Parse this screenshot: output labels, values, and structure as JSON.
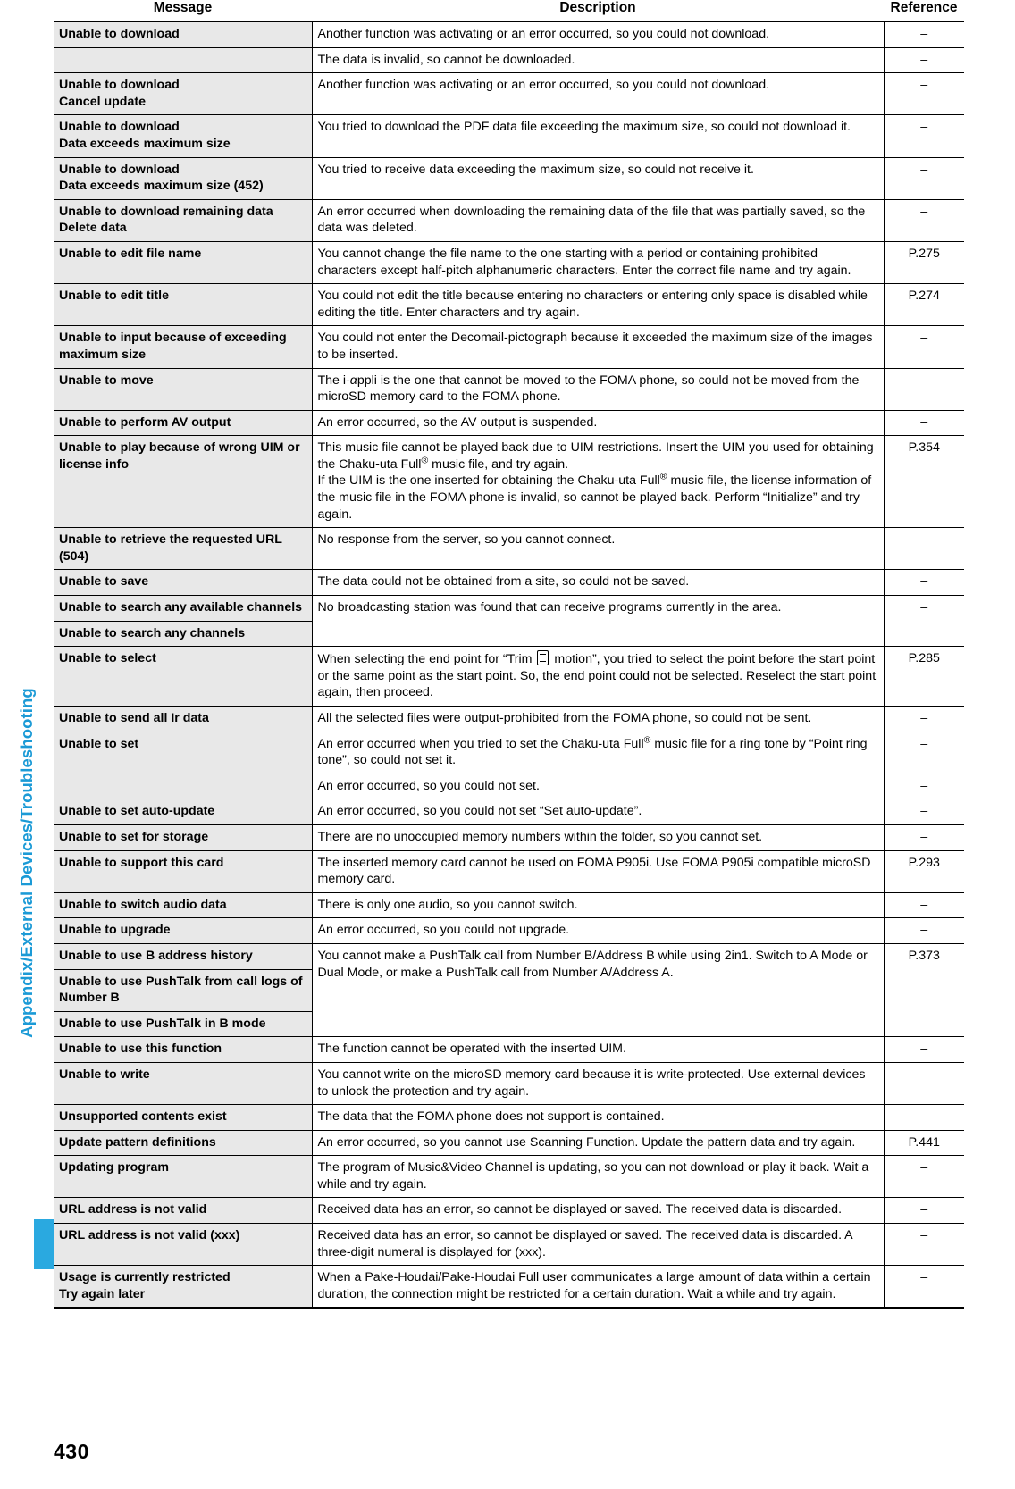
{
  "sidebar": {
    "chapter_label": "Appendix/External Devices/Troubleshooting"
  },
  "footer": {
    "page_number": "430"
  },
  "table": {
    "headers": {
      "message": "Message",
      "description": "Description",
      "reference": "Reference"
    },
    "rows": [
      {
        "message": "Unable to download",
        "description": "Another function was activating or an error occurred, so you could not download.",
        "reference": "–"
      },
      {
        "message": "",
        "description": "The data is invalid, so cannot be downloaded.",
        "reference": "–"
      },
      {
        "message": "Unable to download\nCancel update",
        "description": "Another function was activating or an error occurred, so you could not download.",
        "reference": "–"
      },
      {
        "message": "Unable to download\nData exceeds maximum size",
        "description": "You tried to download the PDF data file exceeding the maximum size, so could not download it.",
        "reference": "–"
      },
      {
        "message": "Unable to download\nData exceeds maximum size (452)",
        "description": "You tried to receive data exceeding the maximum size, so could not receive it.",
        "reference": "–"
      },
      {
        "message": "Unable to download remaining data\nDelete data",
        "description": "An error occurred when downloading the remaining data of the file that was partially saved, so the data was deleted.",
        "reference": "–"
      },
      {
        "message": "Unable to edit file name",
        "description": "You cannot change the file name to the one starting with a period or containing prohibited characters except half-pitch alphanumeric characters. Enter the correct file name and try again.",
        "reference": "P.275"
      },
      {
        "message": "Unable to edit title",
        "description": "You could not edit the title because entering no characters or entering only space is disabled while editing the title. Enter characters and try again.",
        "reference": "P.274"
      },
      {
        "message": "Unable to input because of exceeding maximum size",
        "description": "You could not enter the Decomail-pictograph because it exceeded the maximum size of the images to be inserted.",
        "reference": "–"
      },
      {
        "message": "Unable to move",
        "description": "The i-αppli is the one that cannot be moved to the FOMA phone, so could not be moved from the microSD memory card to the FOMA phone.",
        "reference": "–"
      },
      {
        "message": "Unable to perform AV output",
        "description": "An error occurred, so the AV output is suspended.",
        "reference": "–"
      },
      {
        "message": "Unable to play because of wrong UIM or license info",
        "description": "This music file cannot be played back due to UIM restrictions. Insert the UIM you used for obtaining the Chaku-uta Full® music file, and try again.\nIf the UIM is the one inserted for obtaining the Chaku-uta Full® music file, the license information of the music file in the FOMA phone is invalid, so cannot be played back. Perform “Initialize” and try again.",
        "reference": "P.354"
      },
      {
        "message": "Unable to retrieve the requested URL (504)",
        "description": "No response from the server, so you cannot connect.",
        "reference": "–"
      },
      {
        "message": "Unable to save",
        "description": "The data could not be obtained from a site, so could not be saved.",
        "reference": "–"
      },
      {
        "message": "Unable to search any available channels",
        "description": "No broadcasting station was found that can receive programs currently in the area.",
        "reference": "–"
      },
      {
        "message": "Unable to search any channels",
        "description": "",
        "reference": ""
      },
      {
        "message": "Unable to select",
        "description": "When selecting the end point for “Trim  motion”, you tried to select the point before the start point or the same point as the start point. So, the end point could not be selected. Reselect the start point again, then proceed.",
        "reference": "P.285"
      },
      {
        "message": "Unable to send all Ir data",
        "description": "All the selected files were output-prohibited from the FOMA phone, so could not be sent.",
        "reference": "–"
      },
      {
        "message": "Unable to set",
        "description": "An error occurred when you tried to set the Chaku-uta Full® music file for a ring tone by “Point ring tone”, so could not set it.",
        "reference": "–"
      },
      {
        "message": "",
        "description": "An error occurred, so you could not set.",
        "reference": "–"
      },
      {
        "message": "Unable to set auto-update",
        "description": "An error occurred, so you could not set “Set auto-update”.",
        "reference": "–"
      },
      {
        "message": "Unable to set for storage",
        "description": "There are no unoccupied memory numbers within the folder, so you cannot set.",
        "reference": "–"
      },
      {
        "message": "Unable to support this card",
        "description": "The inserted memory card cannot be used on FOMA P905i. Use FOMA P905i compatible microSD memory card.",
        "reference": "P.293"
      },
      {
        "message": "Unable to switch audio data",
        "description": "There is only one audio, so you cannot switch.",
        "reference": "–"
      },
      {
        "message": "Unable to upgrade",
        "description": "An error occurred, so you could not upgrade.",
        "reference": "–"
      },
      {
        "message": "Unable to use B address history",
        "description": "You cannot make a PushTalk call from Number B/Address B while using 2in1. Switch to A Mode or Dual Mode, or make a PushTalk call from Number A/Address A.",
        "reference": "P.373"
      },
      {
        "message": "Unable to use PushTalk from call logs of Number B",
        "description": "",
        "reference": ""
      },
      {
        "message": "Unable to use PushTalk in B mode",
        "description": "",
        "reference": ""
      },
      {
        "message": "Unable to use this function",
        "description": "The function cannot be operated with the inserted UIM.",
        "reference": "–"
      },
      {
        "message": "Unable to write",
        "description": "You cannot write on the microSD memory card because it is write-protected. Use external devices to unlock the protection and try again.",
        "reference": "–"
      },
      {
        "message": "Unsupported contents exist",
        "description": "The data that the FOMA phone does not support is contained.",
        "reference": "–"
      },
      {
        "message": "Update pattern definitions",
        "description": "An error occurred, so you cannot use Scanning Function. Update the pattern data and try again.",
        "reference": "P.441"
      },
      {
        "message": "Updating program",
        "description": "The program of Music&Video Channel is updating, so you can not download or play it back. Wait a while and try again.",
        "reference": "–"
      },
      {
        "message": "URL address is not valid",
        "description": "Received data has an error, so cannot be displayed or saved. The received data is discarded.",
        "reference": "–"
      },
      {
        "message": "URL address is not valid (xxx)",
        "description": "Received data has an error, so cannot be displayed or saved. The received data is discarded. A three-digit numeral is displayed for (xxx).",
        "reference": "–"
      },
      {
        "message": "Usage is currently restricted\nTry again later",
        "description": "When a Pake-Houdai/Pake-Houdai Full user communicates a large amount of data within a certain duration, the connection might be restricted for a certain duration. Wait a while and try again.",
        "reference": "–"
      }
    ]
  }
}
